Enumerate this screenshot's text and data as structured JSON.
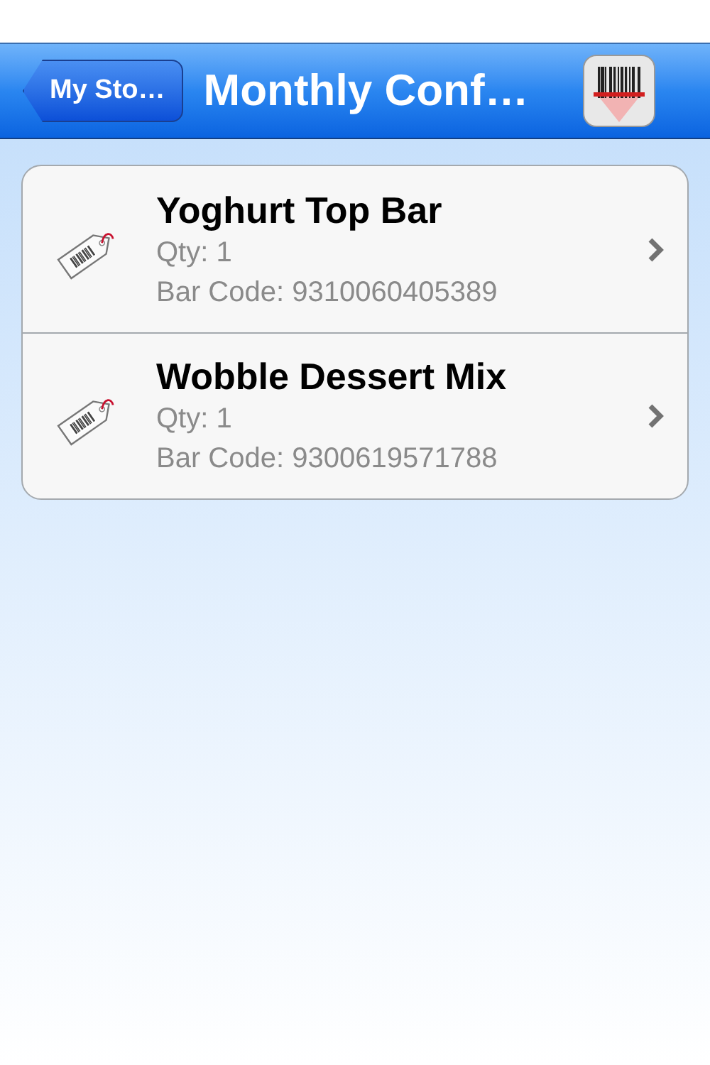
{
  "nav_bar": {
    "back_button": "My Sto…",
    "title": "Monthly Conf…"
  },
  "items": [
    {
      "name": "Yoghurt Top Bar",
      "qty": "Qty: 1",
      "bar_code": "Bar Code: 9310060405389"
    },
    {
      "name": "Wobble Dessert Mix",
      "qty": "Qty: 1",
      "bar_code": "Bar Code: 9300619571788"
    }
  ]
}
